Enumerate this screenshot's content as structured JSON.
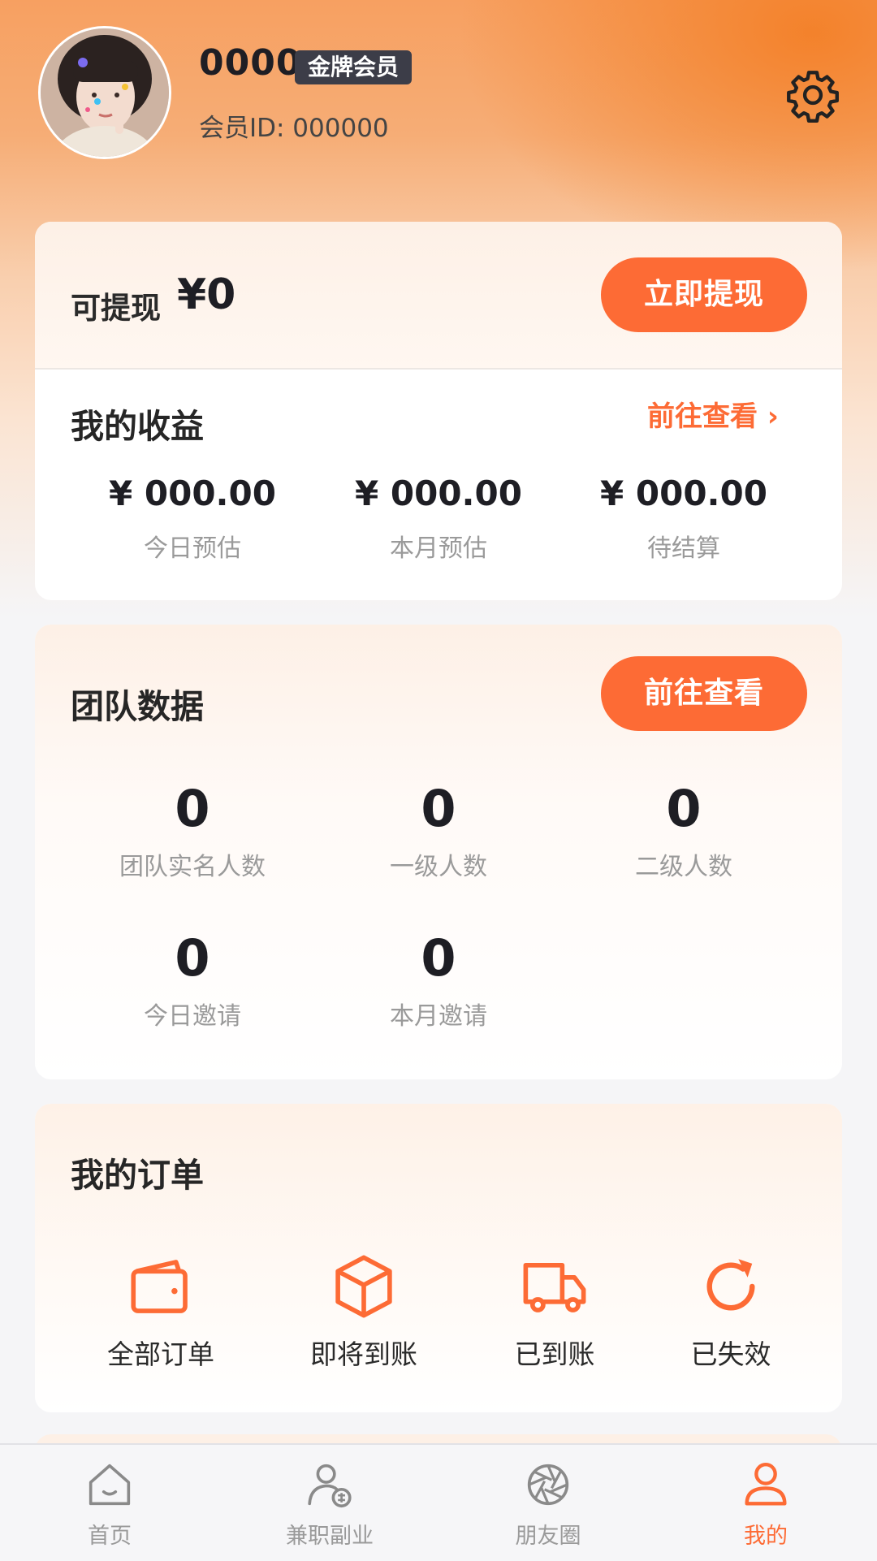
{
  "profile": {
    "username": "0000",
    "member_level": "金牌会员",
    "member_id": "会员ID: 000000"
  },
  "balance": {
    "withdrawable_label": "可提现",
    "withdrawable_amount": "¥0",
    "withdraw_button": "立即提现"
  },
  "earnings": {
    "title": "我的收益",
    "view_link": "前往查看 ›",
    "stats": [
      {
        "value": "¥ 000.00",
        "label": "今日预估"
      },
      {
        "value": "¥ 000.00",
        "label": "本月预估"
      },
      {
        "value": "¥ 000.00",
        "label": "待结算"
      }
    ]
  },
  "team": {
    "title": "团队数据",
    "view_button": "前往查看",
    "stats": [
      {
        "value": "0",
        "label": "团队实名人数"
      },
      {
        "value": "0",
        "label": "一级人数"
      },
      {
        "value": "0",
        "label": "二级人数"
      },
      {
        "value": "0",
        "label": "今日邀请"
      },
      {
        "value": "0",
        "label": "本月邀请"
      }
    ]
  },
  "orders": {
    "title": "我的订单",
    "items": [
      {
        "label": "全部订单",
        "icon": "wallet-icon"
      },
      {
        "label": "即将到账",
        "icon": "box-icon"
      },
      {
        "label": "已到账",
        "icon": "truck-icon"
      },
      {
        "label": "已失效",
        "icon": "refresh-icon"
      }
    ]
  },
  "tabbar": {
    "items": [
      {
        "label": "首页",
        "icon": "home-icon",
        "active": false
      },
      {
        "label": "兼职副业",
        "icon": "user-money-icon",
        "active": false
      },
      {
        "label": "朋友圈",
        "icon": "aperture-icon",
        "active": false
      },
      {
        "label": "我的",
        "icon": "user-icon",
        "active": true
      }
    ]
  },
  "colors": {
    "accent": "#fd6b35",
    "header_orange": "#f38028",
    "badge_dark": "#3c3d48",
    "inactive_gray": "#9a9a9a"
  }
}
